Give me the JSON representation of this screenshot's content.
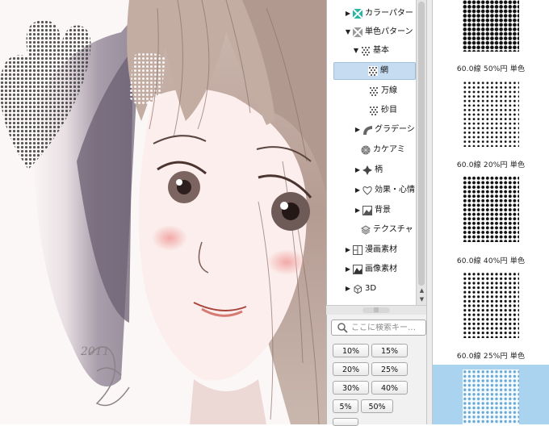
{
  "tree": {
    "items": [
      {
        "label": "カラーパター",
        "expander": "▶",
        "icon": "color-pattern-icon",
        "selected": false
      },
      {
        "label": "単色パターン",
        "expander": "▼",
        "icon": "mono-pattern-icon",
        "selected": false
      },
      {
        "label": "基本",
        "expander": "▼",
        "icon": "dot-tone-icon",
        "selected": false
      },
      {
        "label": "網",
        "expander": "",
        "icon": "dot-tone-icon",
        "selected": true
      },
      {
        "label": "万線",
        "expander": "",
        "icon": "dot-tone-icon",
        "selected": false
      },
      {
        "label": "砂目",
        "expander": "",
        "icon": "dot-tone-icon",
        "selected": false
      },
      {
        "label": "グラデーシ",
        "expander": "▶",
        "icon": "gradation-icon",
        "selected": false
      },
      {
        "label": "カケアミ",
        "expander": "",
        "icon": "kakeami-icon",
        "selected": false
      },
      {
        "label": "柄",
        "expander": "▶",
        "icon": "pattern-icon",
        "selected": false
      },
      {
        "label": "効果・心情",
        "expander": "▶",
        "icon": "heart-icon",
        "selected": false
      },
      {
        "label": "背景",
        "expander": "▶",
        "icon": "background-icon",
        "selected": false
      },
      {
        "label": "テクスチャ",
        "expander": "",
        "icon": "texture-icon",
        "selected": false
      },
      {
        "label": "漫画素材",
        "expander": "▶",
        "icon": "manga-material-icon",
        "selected": false
      },
      {
        "label": "画像素材",
        "expander": "▶",
        "icon": "image-material-icon",
        "selected": false
      },
      {
        "label": "3D",
        "expander": "▶",
        "icon": "cube-3d-icon",
        "selected": false
      }
    ]
  },
  "search": {
    "placeholder": "ここに検索キー…",
    "icon": "search-icon"
  },
  "percent_buttons": [
    "10%",
    "15%",
    "20%",
    "25%",
    "30%",
    "40%",
    "5%",
    "50%"
  ],
  "patterns": [
    {
      "label": "60.0線 50%円 単色"
    },
    {
      "label": "60.0線 20%円 単色"
    },
    {
      "label": "60.0線 40%円 単色"
    },
    {
      "label": "60.0線 25%円 単色"
    }
  ],
  "signature": "2011"
}
